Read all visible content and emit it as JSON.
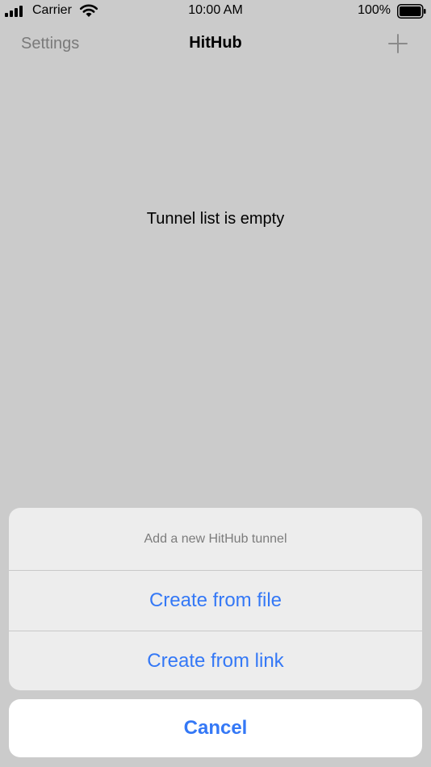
{
  "status_bar": {
    "carrier": "Carrier",
    "time": "10:00 AM",
    "battery": "100%"
  },
  "nav": {
    "left_label": "Settings",
    "title": "HitHub",
    "right_icon": "plus-icon"
  },
  "content": {
    "empty_message": "Tunnel list is empty"
  },
  "action_sheet": {
    "title": "Add a new HitHub tunnel",
    "options": [
      {
        "label": "Create from file"
      },
      {
        "label": "Create from link"
      }
    ],
    "cancel_label": "Cancel"
  },
  "colors": {
    "accent": "#3478f6",
    "background": "#cbcbcb",
    "sheet": "#ededed"
  }
}
